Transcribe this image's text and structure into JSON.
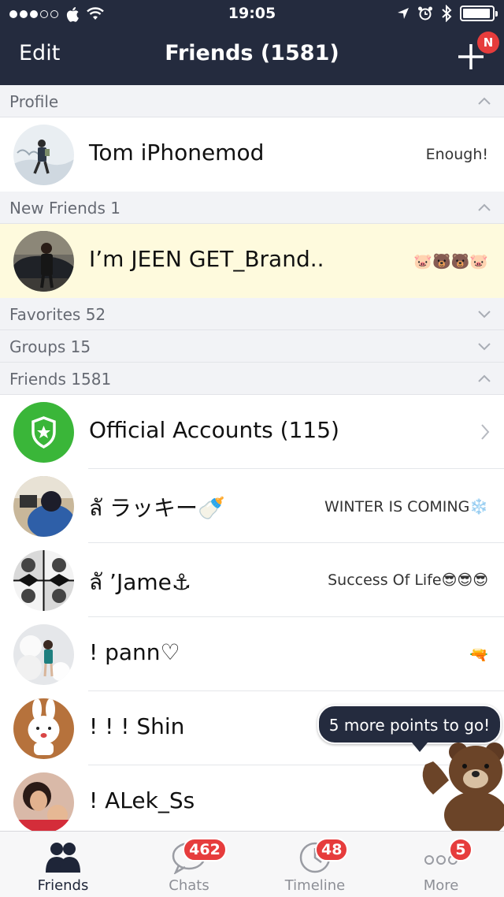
{
  "status_bar": {
    "time": "19:05",
    "signal_dots_filled": 3,
    "signal_dots_total": 5
  },
  "nav": {
    "edit_label": "Edit",
    "title": "Friends (1581)",
    "add_icon": "plus-icon",
    "new_badge": "N"
  },
  "sections": {
    "profile": "Profile",
    "new_friends": "New Friends 1",
    "favorites": "Favorites 52",
    "groups": "Groups 15",
    "friends": "Friends 1581"
  },
  "profile": {
    "name": "Tom iPhonemod",
    "status": "Enough!"
  },
  "new_friend": {
    "name": "I’m JEEN GET_Brand..",
    "status": "🐷🐻🐻🐷"
  },
  "official": {
    "name": "Official Accounts (115)"
  },
  "friends": [
    {
      "name": "ลั      ラッキー🍼",
      "status": "WINTER IS COMING❄️"
    },
    {
      "name": "ลั    ’Jame⚓",
      "status": "Success Of Life😎😎😎"
    },
    {
      "name": "!     pann♡",
      "status": "🔫"
    },
    {
      "name": "! ! ! Shin",
      "status": ""
    },
    {
      "name": "! ALek_Ss",
      "status": ""
    }
  ],
  "tabs": [
    {
      "label": "Friends",
      "icon": "friends-icon",
      "badge": ""
    },
    {
      "label": "Chats",
      "icon": "chat-bubble-icon",
      "badge": "462"
    },
    {
      "label": "Timeline",
      "icon": "clock-icon",
      "badge": "48"
    },
    {
      "label": "More",
      "icon": "more-dots-icon",
      "badge": "5"
    }
  ],
  "popup": {
    "text": "5 more points to go!"
  },
  "colors": {
    "nav_bg": "#242b3e",
    "badge_red": "#e63c3c",
    "official_green": "#3ab639",
    "highlight_row": "#fefadd"
  }
}
